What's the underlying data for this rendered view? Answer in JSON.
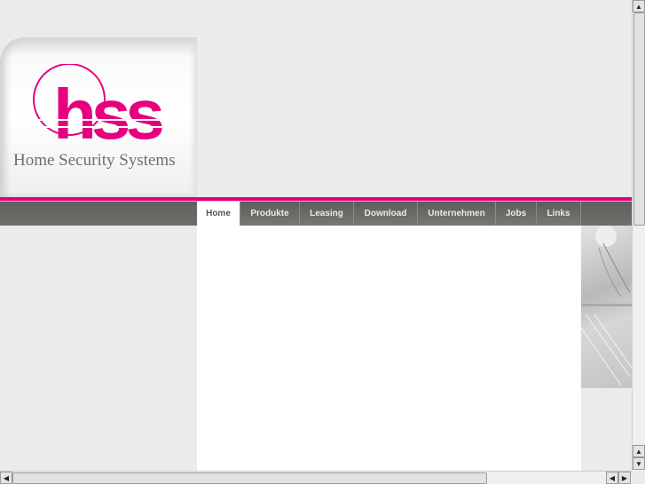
{
  "logo": {
    "letters": "hss",
    "tagline": "Home Security Systems"
  },
  "nav": {
    "tabs": [
      {
        "label": "Home",
        "active": true
      },
      {
        "label": "Produkte"
      },
      {
        "label": "Leasing"
      },
      {
        "label": "Download"
      },
      {
        "label": "Unternehmen"
      },
      {
        "label": "Jobs"
      },
      {
        "label": "Links"
      }
    ]
  },
  "colors": {
    "brand": "#e6007e",
    "nav": "#62655e",
    "background": "#ebebeb"
  },
  "icons": {
    "up": "arrow-up-icon",
    "down": "arrow-down-icon",
    "left": "arrow-left-icon",
    "right": "arrow-right-icon"
  }
}
